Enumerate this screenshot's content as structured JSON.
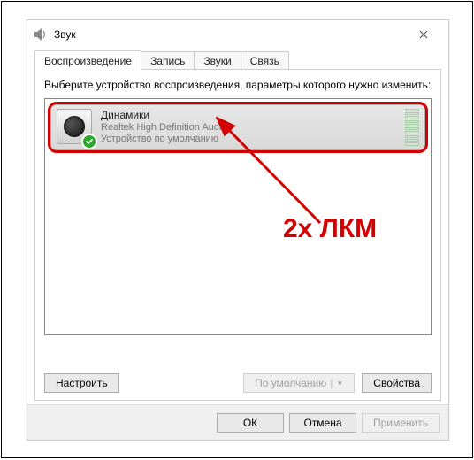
{
  "window": {
    "title": "Звук"
  },
  "tabs": {
    "playback": "Воспроизведение",
    "record": "Запись",
    "sounds": "Звуки",
    "comm": "Связь"
  },
  "instruction": "Выберите устройство воспроизведения, параметры которого нужно изменить:",
  "device": {
    "name": "Динамики",
    "driver": "Realtek High Definition Audio",
    "status": "Устройство по умолчанию"
  },
  "panelButtons": {
    "configure": "Настроить",
    "default": "По умолчанию",
    "properties": "Свойства"
  },
  "dialogButtons": {
    "ok": "ОК",
    "cancel": "Отмена",
    "apply": "Применить"
  },
  "annotation": {
    "text": "2х ЛКМ"
  }
}
